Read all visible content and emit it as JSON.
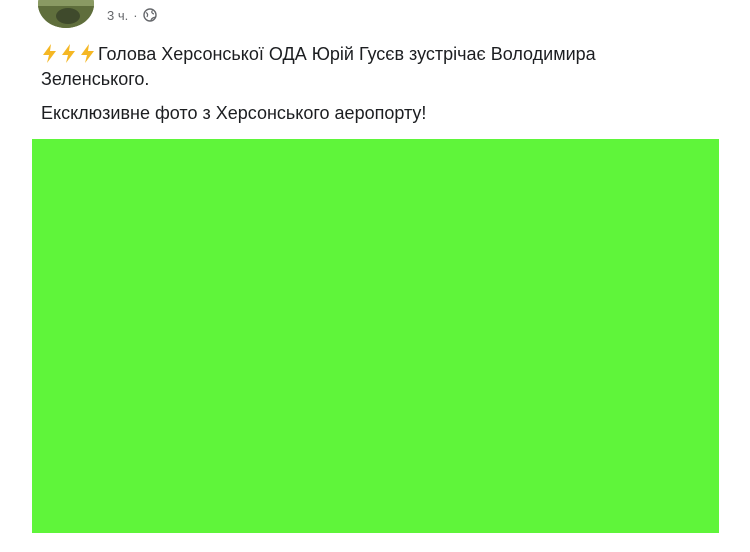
{
  "post": {
    "timestamp": "3 ч.",
    "separator": "·",
    "privacy_icon": "globe-icon",
    "emoji_icon": "high-voltage-icon",
    "headline": "Голова Херсонської ОДА Юрій Гусєв зустрічає Володимира Зеленського.",
    "caption": "Ексклюзивне фото з Херсонського аеропорту!",
    "photo_color": "#5ff53a"
  }
}
